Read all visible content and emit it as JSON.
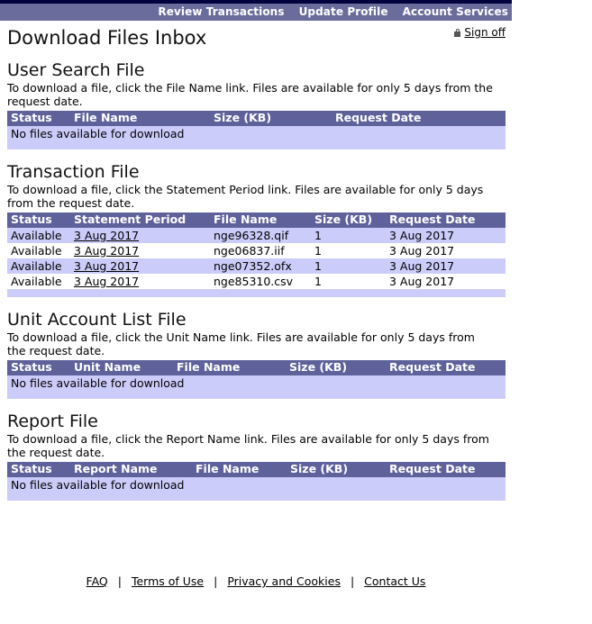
{
  "nav": {
    "items": [
      {
        "label": "Review Transactions"
      },
      {
        "label": "Update Profile"
      },
      {
        "label": "Account Services"
      }
    ]
  },
  "header": {
    "title": "Download Files Inbox",
    "signoff_label": "Sign off",
    "signoff_icon": "lock-icon"
  },
  "colors": {
    "nav_top_strip": "#00003c",
    "nav_background": "#6a6d9b",
    "table_header": "#5e619a",
    "table_row_alt": "#ccccfb",
    "text": "#000000"
  },
  "sections": [
    {
      "id": "user-search-file",
      "title": "User Search File",
      "description": "To download a file, click the File Name link. Files are available for only 5 days from the request date.",
      "columns": [
        "Status",
        "File Name",
        "Size (KB)",
        "Request Date"
      ],
      "empty_message": "No files available for download",
      "rows": []
    },
    {
      "id": "transaction-file",
      "title": "Transaction File",
      "description": "To download a file, click the Statement Period link. Files are available for only 5 days from the request date.",
      "columns": [
        "Status",
        "Statement Period",
        "File Name",
        "Size (KB)",
        "Request Date"
      ],
      "empty_message": "",
      "rows": [
        {
          "status": "Available",
          "statement_period": "3 Aug 2017",
          "file_name": "nge96328.qif",
          "size": "1",
          "request_date": "3 Aug 2017"
        },
        {
          "status": "Available",
          "statement_period": "3 Aug 2017",
          "file_name": "nge06837.iif",
          "size": "1",
          "request_date": "3 Aug 2017"
        },
        {
          "status": "Available",
          "statement_period": "3 Aug 2017",
          "file_name": "nge07352.ofx",
          "size": "1",
          "request_date": "3 Aug 2017"
        },
        {
          "status": "Available",
          "statement_period": "3 Aug 2017",
          "file_name": "nge85310.csv",
          "size": "1",
          "request_date": "3 Aug 2017"
        }
      ]
    },
    {
      "id": "unit-account-list-file",
      "title": "Unit Account List File",
      "description": "To download a file, click the Unit Name link. Files are available for only 5 days from the request date.",
      "columns": [
        "Status",
        "Unit Name",
        "File Name",
        "Size (KB)",
        "Request Date"
      ],
      "empty_message": "No files available for download",
      "rows": []
    },
    {
      "id": "report-file",
      "title": "Report File",
      "description": "To download a file, click the Report Name link. Files are available for only 5 days from the request date.",
      "columns": [
        "Status",
        "Report Name",
        "File Name",
        "Size (KB)",
        "Request Date"
      ],
      "empty_message": "No files available for download",
      "rows": []
    }
  ],
  "footer": {
    "separator": "|",
    "links": [
      {
        "label": "FAQ"
      },
      {
        "label": "Terms of Use"
      },
      {
        "label": "Privacy and Cookies"
      },
      {
        "label": "Contact Us"
      }
    ]
  }
}
